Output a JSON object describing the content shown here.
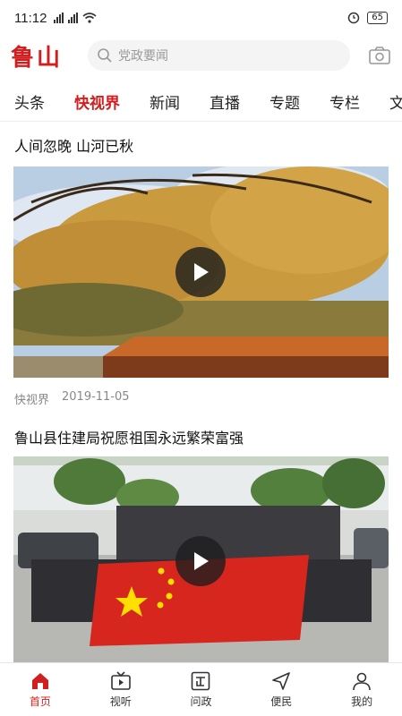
{
  "status": {
    "time": "11:12",
    "battery": "65"
  },
  "header": {
    "logo": "鲁山",
    "search_placeholder": "党政要闻"
  },
  "tabs": [
    {
      "label": "头条"
    },
    {
      "label": "快视界"
    },
    {
      "label": "新闻"
    },
    {
      "label": "直播"
    },
    {
      "label": "专题"
    },
    {
      "label": "专栏"
    },
    {
      "label": "文化"
    }
  ],
  "active_tab": "快视界",
  "feed": [
    {
      "title": "人间忽晚 山河已秋",
      "source": "快视界",
      "date": "2019-11-05"
    },
    {
      "title": "鲁山县住建局祝愿祖国永远繁荣富强"
    }
  ],
  "nav": [
    {
      "label": "首页",
      "icon": "home-icon"
    },
    {
      "label": "视听",
      "icon": "tv-icon"
    },
    {
      "label": "问政",
      "icon": "zheng-icon"
    },
    {
      "label": "便民",
      "icon": "send-icon"
    },
    {
      "label": "我的",
      "icon": "user-icon"
    }
  ],
  "colors": {
    "accent": "#d21e1e"
  }
}
